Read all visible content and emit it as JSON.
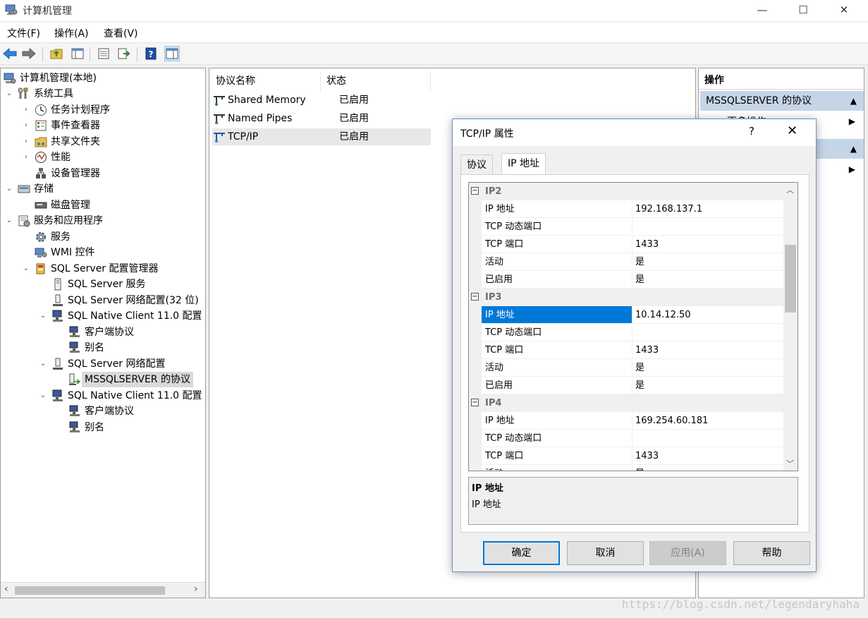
{
  "window": {
    "title": "计算机管理",
    "minimize": "—",
    "maximize": "☐",
    "close": "✕"
  },
  "menu": {
    "file": "文件(F)",
    "action": "操作(A)",
    "view": "查看(V)"
  },
  "tree": {
    "items": [
      {
        "label": "计算机管理(本地)"
      },
      {
        "label": "系统工具"
      },
      {
        "label": "任务计划程序"
      },
      {
        "label": "事件查看器"
      },
      {
        "label": "共享文件夹"
      },
      {
        "label": "性能"
      },
      {
        "label": "设备管理器"
      },
      {
        "label": "存储"
      },
      {
        "label": "磁盘管理"
      },
      {
        "label": "服务和应用程序"
      },
      {
        "label": "服务"
      },
      {
        "label": "WMI 控件"
      },
      {
        "label": "SQL Server 配置管理器"
      },
      {
        "label": "SQL Server 服务"
      },
      {
        "label": "SQL Server 网络配置(32 位)"
      },
      {
        "label": "SQL Native Client 11.0 配置"
      },
      {
        "label": "客户端协议"
      },
      {
        "label": "别名"
      },
      {
        "label": "SQL Server 网络配置"
      },
      {
        "label": "MSSQLSERVER 的协议"
      },
      {
        "label": "SQL Native Client 11.0 配置"
      },
      {
        "label": "客户端协议"
      },
      {
        "label": "别名"
      }
    ]
  },
  "list": {
    "col_name": "协议名称",
    "col_status": "状态",
    "rows": [
      {
        "name": "Shared Memory",
        "status": "已启用"
      },
      {
        "name": "Named Pipes",
        "status": "已启用"
      },
      {
        "name": "TCP/IP",
        "status": "已启用"
      }
    ]
  },
  "actions": {
    "header": "操作",
    "group1": "MSSQLSERVER 的协议",
    "group1_link": "更多操作"
  },
  "dialog": {
    "title": "TCP/IP 属性",
    "help": "?",
    "close": "✕",
    "tabs": [
      "协议",
      "IP 地址"
    ],
    "grid": {
      "ip2": {
        "name": "IP2",
        "ip_label": "IP 地址",
        "ip": "192.168.137.1",
        "dyn_label": "TCP 动态端口",
        "dyn": "",
        "port_label": "TCP 端口",
        "port": "1433",
        "active_label": "活动",
        "active": "是",
        "enabled_label": "已启用",
        "enabled": "是"
      },
      "ip3": {
        "name": "IP3",
        "ip_label": "IP 地址",
        "ip": "10.14.12.50",
        "dyn_label": "TCP 动态端口",
        "dyn": "",
        "port_label": "TCP 端口",
        "port": "1433",
        "active_label": "活动",
        "active": "是",
        "enabled_label": "已启用",
        "enabled": "是"
      },
      "ip4": {
        "name": "IP4",
        "ip_label": "IP 地址",
        "ip": "169.254.60.181",
        "dyn_label": "TCP 动态端口",
        "dyn": "",
        "port_label": "TCP 端口",
        "port": "1433",
        "active_label": "活动",
        "active": "是"
      }
    },
    "desc_title": "IP 地址",
    "desc_text": "IP 地址",
    "buttons": {
      "ok": "确定",
      "cancel": "取消",
      "apply": "应用(A)",
      "help": "帮助"
    }
  },
  "watermark": "https://blog.csdn.net/legendaryhaha",
  "colors": {
    "accent": "#0078d7",
    "action_group": "#c5d5e8"
  }
}
